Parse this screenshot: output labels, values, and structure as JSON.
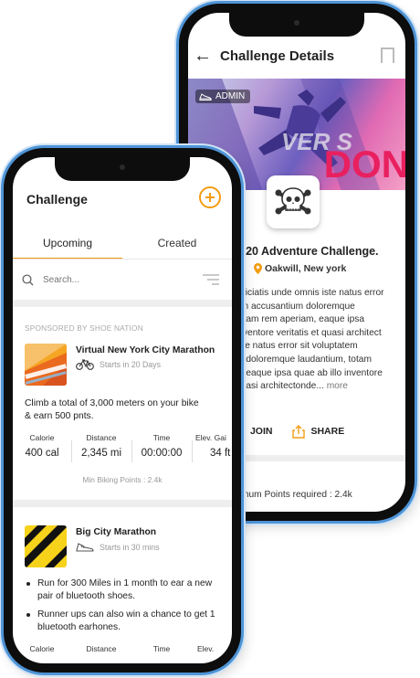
{
  "details": {
    "title": "Challenge Details",
    "admin_label": "ADMIN",
    "banner_text_1": "VER S",
    "banner_text_2": "DON",
    "challenge_name": "n 20 Adventure Challenge.",
    "location": "Oakwill, New york",
    "description": "spiciatis unde omnis iste natus error\nem accusantium doloremque\ntotam rem aperiam, eaque ipsa\ninventore veritatis et quasi architect\niste natus error sit voluptatem\nm doloremque laudantium, totam\nn, eaque ipsa quae ab illo inventore\nquasi architectonde...",
    "more": "more",
    "join_label": "JOIN",
    "share_label": "SHARE",
    "points_required": "mum Points required : 2.4k"
  },
  "list": {
    "title": "Challenge",
    "tabs": {
      "upcoming": "Upcoming",
      "created": "Created"
    },
    "search_placeholder": "Search...",
    "sponsor_label": "SPONSORED BY SHOE NATION",
    "card1": {
      "name": "Virtual New York City Marathon",
      "starts": "Starts in 20 Days",
      "description": "Climb a total of 3,000 meters on your bike & earn 500 pnts.",
      "stats": [
        {
          "label": "Calorie",
          "value": "400 cal"
        },
        {
          "label": "Distance",
          "value": "2,345 mi"
        },
        {
          "label": "Time",
          "value": "00:00:00"
        },
        {
          "label": "Elev. Gai",
          "value": "34 ft"
        }
      ],
      "min_points": "Min Biking Points : 2.4k"
    },
    "card2": {
      "name": "Big City Marathon",
      "starts": "Starts in 30 mins",
      "bullets": [
        "Run for 300 Miles in 1 month to ear a new pair of bluetooth shoes.",
        "Runner ups can also win a chance to get 1 bluetooth earhones."
      ],
      "stats": [
        {
          "label": "Calorie"
        },
        {
          "label": "Distance"
        },
        {
          "label": "Time"
        },
        {
          "label": "Elev."
        }
      ]
    }
  },
  "colors": {
    "accent": "#f39c12",
    "frame": "#4e94d6",
    "banner_text": "#e8205f"
  }
}
